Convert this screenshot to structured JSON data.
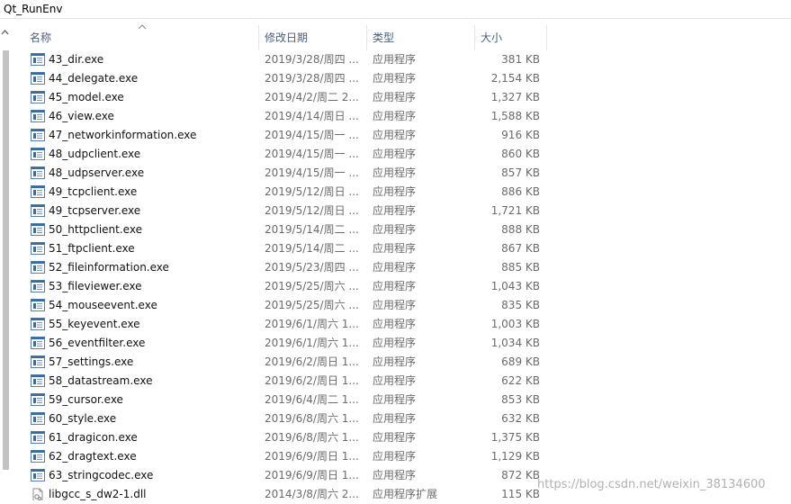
{
  "window": {
    "title": "Qt_RunEnv"
  },
  "columns": {
    "name": "名称",
    "date": "修改日期",
    "type": "类型",
    "size": "大小"
  },
  "colors": {
    "header_text": "#4c607a",
    "meta_text": "#6b6b6b",
    "scroll_thumb": "#c2c2c2"
  },
  "files": [
    {
      "name": "43_dir.exe",
      "date": "2019/3/28/周四 ...",
      "type": "应用程序",
      "size": "381 KB",
      "icon": "exe-icon"
    },
    {
      "name": "44_delegate.exe",
      "date": "2019/3/28/周四 ...",
      "type": "应用程序",
      "size": "2,154 KB",
      "icon": "exe-icon"
    },
    {
      "name": "45_model.exe",
      "date": "2019/4/2/周二 2...",
      "type": "应用程序",
      "size": "1,327 KB",
      "icon": "exe-icon"
    },
    {
      "name": "46_view.exe",
      "date": "2019/4/14/周日 ...",
      "type": "应用程序",
      "size": "1,588 KB",
      "icon": "exe-icon"
    },
    {
      "name": "47_networkinformation.exe",
      "date": "2019/4/15/周一 ...",
      "type": "应用程序",
      "size": "916 KB",
      "icon": "exe-icon"
    },
    {
      "name": "48_udpclient.exe",
      "date": "2019/4/15/周一 ...",
      "type": "应用程序",
      "size": "860 KB",
      "icon": "exe-icon"
    },
    {
      "name": "48_udpserver.exe",
      "date": "2019/4/15/周一 ...",
      "type": "应用程序",
      "size": "857 KB",
      "icon": "exe-icon"
    },
    {
      "name": "49_tcpclient.exe",
      "date": "2019/5/12/周日 ...",
      "type": "应用程序",
      "size": "886 KB",
      "icon": "exe-icon"
    },
    {
      "name": "49_tcpserver.exe",
      "date": "2019/5/12/周日 ...",
      "type": "应用程序",
      "size": "1,721 KB",
      "icon": "exe-icon"
    },
    {
      "name": "50_httpclient.exe",
      "date": "2019/5/14/周二 ...",
      "type": "应用程序",
      "size": "888 KB",
      "icon": "exe-icon"
    },
    {
      "name": "51_ftpclient.exe",
      "date": "2019/5/14/周二 ...",
      "type": "应用程序",
      "size": "867 KB",
      "icon": "exe-icon"
    },
    {
      "name": "52_fileinformation.exe",
      "date": "2019/5/23/周四 ...",
      "type": "应用程序",
      "size": "885 KB",
      "icon": "exe-icon"
    },
    {
      "name": "53_fileviewer.exe",
      "date": "2019/5/25/周六 ...",
      "type": "应用程序",
      "size": "1,043 KB",
      "icon": "exe-icon"
    },
    {
      "name": "54_mouseevent.exe",
      "date": "2019/5/25/周六 ...",
      "type": "应用程序",
      "size": "835 KB",
      "icon": "exe-icon"
    },
    {
      "name": "55_keyevent.exe",
      "date": "2019/6/1/周六 1...",
      "type": "应用程序",
      "size": "1,003 KB",
      "icon": "exe-icon"
    },
    {
      "name": "56_eventfilter.exe",
      "date": "2019/6/1/周六 1...",
      "type": "应用程序",
      "size": "1,034 KB",
      "icon": "exe-icon"
    },
    {
      "name": "57_settings.exe",
      "date": "2019/6/2/周日 1...",
      "type": "应用程序",
      "size": "689 KB",
      "icon": "exe-icon"
    },
    {
      "name": "58_datastream.exe",
      "date": "2019/6/2/周日 1...",
      "type": "应用程序",
      "size": "622 KB",
      "icon": "exe-icon"
    },
    {
      "name": "59_cursor.exe",
      "date": "2019/6/4/周二 1...",
      "type": "应用程序",
      "size": "853 KB",
      "icon": "exe-icon"
    },
    {
      "name": "60_style.exe",
      "date": "2019/6/8/周六 1...",
      "type": "应用程序",
      "size": "632 KB",
      "icon": "exe-icon"
    },
    {
      "name": "61_dragicon.exe",
      "date": "2019/6/8/周六 1...",
      "type": "应用程序",
      "size": "1,375 KB",
      "icon": "exe-icon"
    },
    {
      "name": "62_dragtext.exe",
      "date": "2019/6/9/周日 1...",
      "type": "应用程序",
      "size": "1,129 KB",
      "icon": "exe-icon"
    },
    {
      "name": "63_stringcodec.exe",
      "date": "2019/6/9/周日 1...",
      "type": "应用程序",
      "size": "872 KB",
      "icon": "exe-icon"
    },
    {
      "name": "libgcc_s_dw2-1.dll",
      "date": "2014/3/8/周六 2...",
      "type": "应用程序扩展",
      "size": "115 KB",
      "icon": "dll-icon"
    }
  ],
  "watermark": "https://blog.csdn.net/weixin_38134600"
}
